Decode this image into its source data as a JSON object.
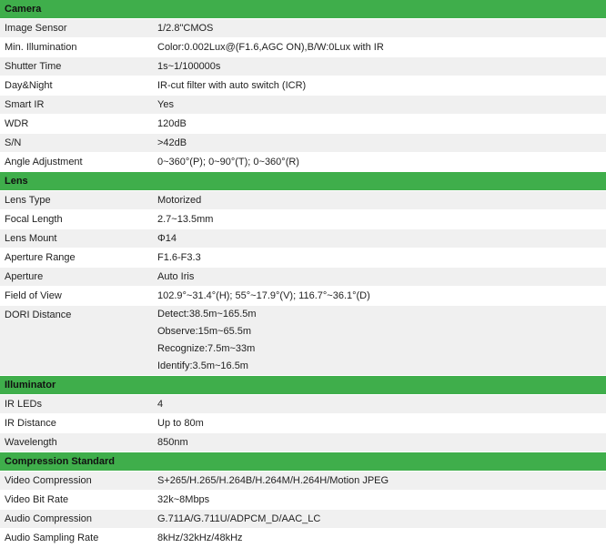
{
  "sections": [
    {
      "title": "Camera",
      "rows": [
        {
          "label": "Image Sensor",
          "value": "1/2.8\"CMOS"
        },
        {
          "label": "Min. Illumination",
          "value": "Color:0.002Lux@(F1.6,AGC ON),B/W:0Lux with IR"
        },
        {
          "label": "Shutter Time",
          "value": "1s~1/100000s"
        },
        {
          "label": "Day&Night",
          "value": "IR-cut filter with auto switch (ICR)"
        },
        {
          "label": "Smart IR",
          "value": "Yes"
        },
        {
          "label": "WDR",
          "value": "120dB"
        },
        {
          "label": "S/N",
          "value": ">42dB"
        },
        {
          "label": "Angle Adjustment",
          "value": "0~360°(P); 0~90°(T); 0~360°(R)"
        }
      ]
    },
    {
      "title": "Lens",
      "rows": [
        {
          "label": "Lens Type",
          "value": "Motorized"
        },
        {
          "label": "Focal Length",
          "value": "2.7~13.5mm"
        },
        {
          "label": "Lens Mount",
          "value": "Φ14"
        },
        {
          "label": "Aperture Range",
          "value": "F1.6-F3.3"
        },
        {
          "label": "Aperture",
          "value": "Auto Iris"
        },
        {
          "label": "Field of View",
          "value": "102.9°~31.4°(H); 55°~17.9°(V); 116.7°~36.1°(D)"
        },
        {
          "label": "DORI Distance",
          "lines": [
            "Detect:38.5m~165.5m",
            "Observe:15m~65.5m",
            "Recognize:7.5m~33m",
            "Identify:3.5m~16.5m"
          ]
        }
      ]
    },
    {
      "title": "Illuminator",
      "rows": [
        {
          "label": "IR LEDs",
          "value": "4"
        },
        {
          "label": "IR Distance",
          "value": "Up to 80m"
        },
        {
          "label": "Wavelength",
          "value": "850nm"
        }
      ]
    },
    {
      "title": "Compression Standard",
      "rows": [
        {
          "label": "Video Compression",
          "value": "S+265/H.265/H.264B/H.264M/H.264H/Motion JPEG"
        },
        {
          "label": "Video Bit Rate",
          "value": "32k~8Mbps"
        },
        {
          "label": "Audio Compression",
          "value": "G.711A/G.711U/ADPCM_D/AAC_LC"
        },
        {
          "label": "Audio Sampling Rate",
          "value": "8kHz/32kHz/48kHz"
        }
      ]
    }
  ]
}
